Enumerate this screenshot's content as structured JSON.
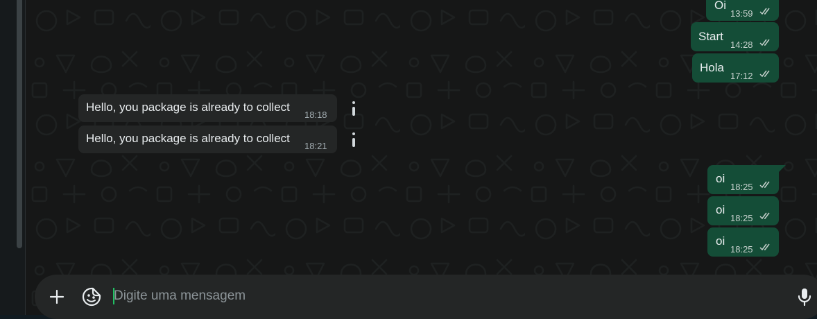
{
  "messages": {
    "m1": {
      "text": "Oi",
      "time": "13:59"
    },
    "m2": {
      "text": "Start",
      "time": "14:28"
    },
    "m3": {
      "text": "Hola",
      "time": "17:12"
    },
    "m4": {
      "text": "Hello, you package is already to collect",
      "time": "18:18"
    },
    "m5": {
      "text": "Hello, you package is already to collect",
      "time": "18:21"
    },
    "m6": {
      "text": "oi",
      "time": "18:25"
    },
    "m7": {
      "text": "oi",
      "time": "18:25"
    },
    "m8": {
      "text": "oi",
      "time": "18:25"
    }
  },
  "composer": {
    "placeholder": "Digite uma mensagem",
    "attach_icon": "plus-icon",
    "sticker_icon": "sticker-icon",
    "mic_icon": "microphone-icon"
  },
  "colors": {
    "outgoing_bubble": "#144d37",
    "incoming_bubble": "#242626",
    "accent": "#21c063"
  }
}
